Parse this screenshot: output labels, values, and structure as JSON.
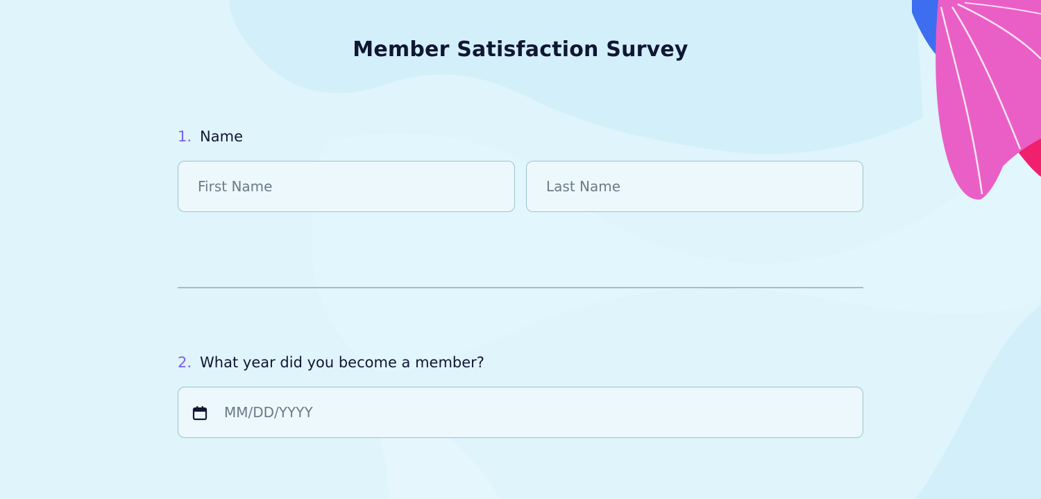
{
  "survey": {
    "title": "Member Satisfaction Survey"
  },
  "questions": [
    {
      "number": "1.",
      "label": "Name",
      "fields": [
        {
          "placeholder": "First Name",
          "value": ""
        },
        {
          "placeholder": "Last Name",
          "value": ""
        }
      ]
    },
    {
      "number": "2.",
      "label": "What year did you become a member?",
      "date_field": {
        "placeholder": "MM/DD/YYYY",
        "value": "",
        "icon": "calendar-icon"
      }
    }
  ],
  "colors": {
    "background": "#dff4fb",
    "accent_number": "#7b5ee8",
    "text": "#101633",
    "field_border": "#9cc3cf",
    "decor_pink": "#ea5fc6",
    "decor_blue": "#3d6ef0"
  }
}
